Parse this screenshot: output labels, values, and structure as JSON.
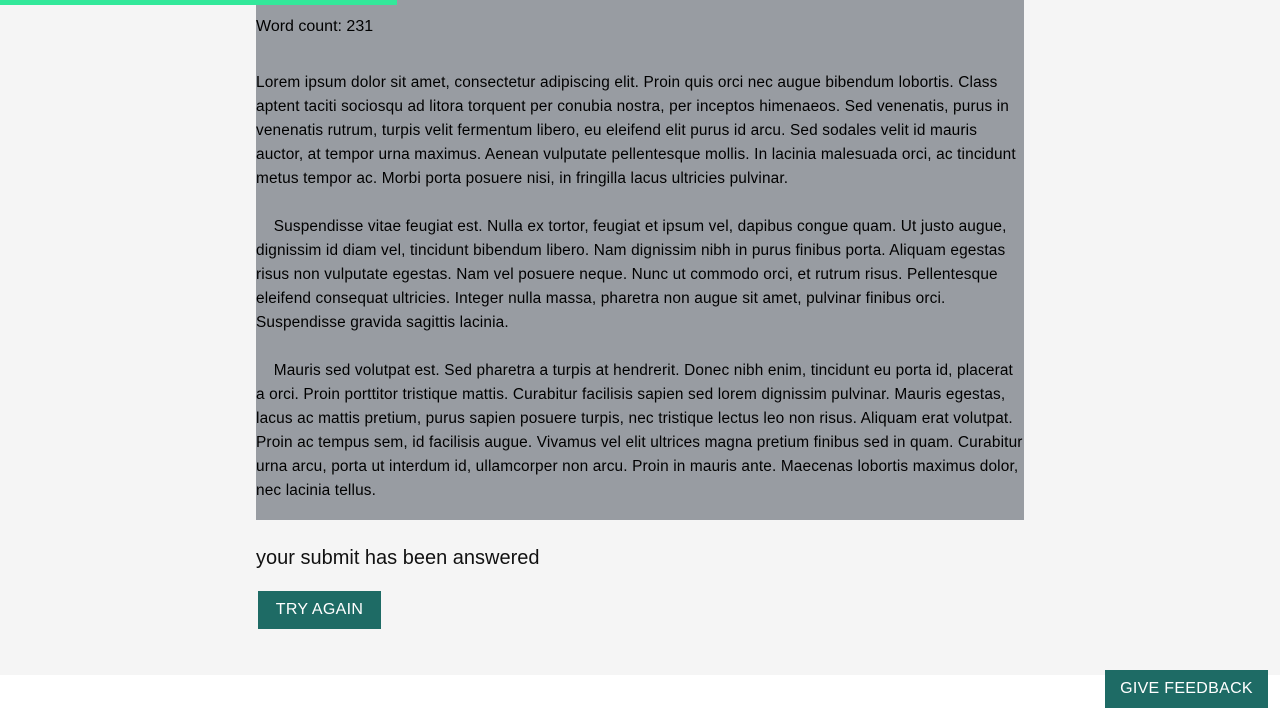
{
  "progress": {
    "fraction": 0.31,
    "color": "#33e89a"
  },
  "reading": {
    "word_count_label": "Word count: 231",
    "paragraphs": [
      "Lorem ipsum dolor sit amet, consectetur adipiscing elit. Proin quis orci nec augue bibendum lobortis. Class aptent taciti sociosqu ad litora torquent per conubia nostra, per inceptos himenaeos. Sed venenatis, purus in venenatis rutrum, turpis velit fermentum libero, eu eleifend elit purus id arcu. Sed sodales velit id mauris auctor, at tempor urna maximus. Aenean vulputate pellentesque mollis. In lacinia malesuada orci, ac tincidunt metus tempor ac. Morbi porta posuere nisi, in fringilla lacus ultricies pulvinar.",
      "    Suspendisse vitae feugiat est. Nulla ex tortor, feugiat et ipsum vel, dapibus congue quam. Ut justo augue, dignissim id diam vel, tincidunt bibendum libero. Nam dignissim nibh in purus finibus porta. Aliquam egestas risus non vulputate egestas. Nam vel posuere neque. Nunc ut commodo orci, et rutrum risus. Pellentesque eleifend consequat ultricies. Integer nulla massa, pharetra non augue sit amet, pulvinar finibus orci. Suspendisse gravida sagittis lacinia.",
      "    Mauris sed volutpat est. Sed pharetra a turpis at hendrerit. Donec nibh enim, tincidunt eu porta id, placerat a orci. Proin porttitor tristique mattis. Curabitur facilisis sapien sed lorem dignissim pulvinar. Mauris egestas, lacus ac mattis pretium, purus sapien posuere turpis, nec tristique lectus leo non risus. Aliquam erat volutpat. Proin ac tempus sem, id facilisis augue. Vivamus vel elit ultrices magna pretium finibus sed in quam. Curabitur urna arcu, porta ut interdum id, ullamcorper non arcu. Proin in mauris ante. Maecenas lobortis maximus dolor, nec lacinia tellus."
    ]
  },
  "result": {
    "status_text": "your submit has been answered",
    "try_again_label": "TRY AGAIN"
  },
  "footer": {
    "feedback_label": "GIVE FEEDBACK"
  },
  "colors": {
    "button_bg": "#1e6b65",
    "panel_bg": "#989ca2",
    "page_bg": "#f5f5f5"
  }
}
